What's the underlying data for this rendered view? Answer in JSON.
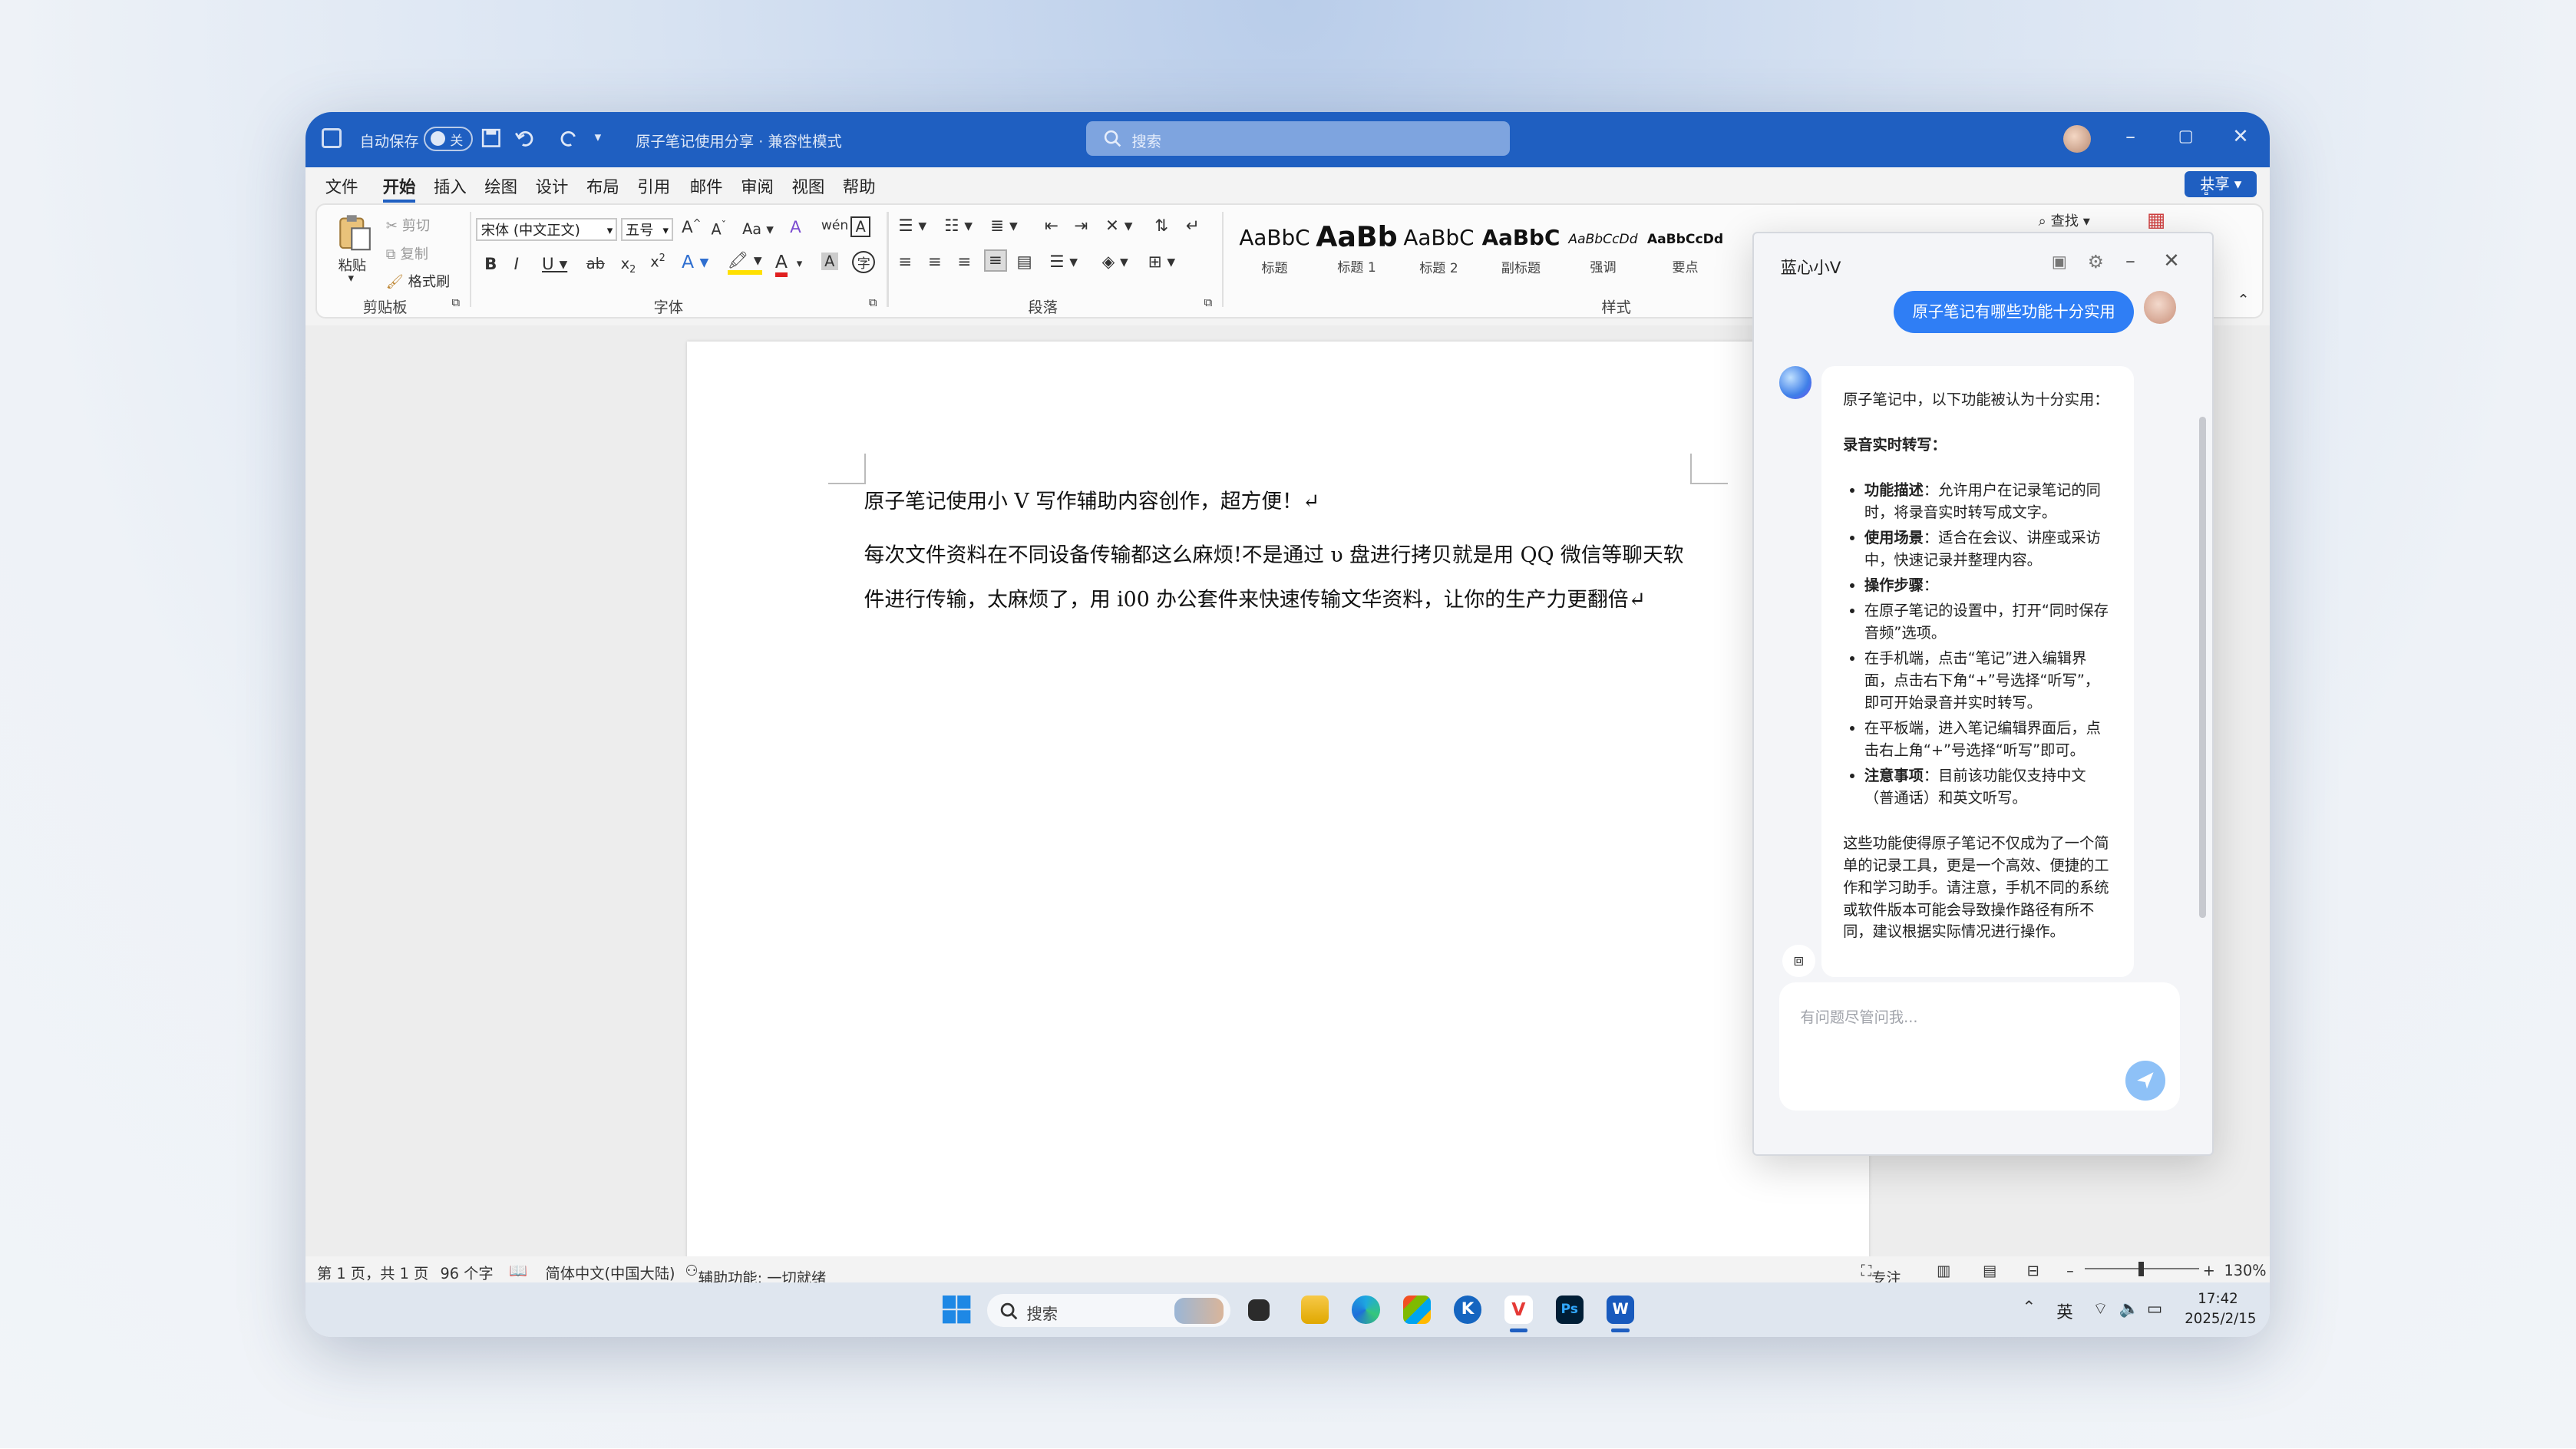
{
  "titlebar": {
    "autosave": "自动保存",
    "toggle": "关",
    "doc_title": "原子笔记使用分享 · 兼容性模式",
    "search_placeholder": "搜索"
  },
  "menu": [
    "文件",
    "开始",
    "插入",
    "绘图",
    "设计",
    "布局",
    "引用",
    "邮件",
    "审阅",
    "视图",
    "帮助"
  ],
  "share": "共享",
  "ribbon": {
    "paste": "粘贴",
    "cut": "剪切",
    "copy": "复制",
    "format_painter": "格式刷",
    "clipboard": "剪贴板",
    "font_name": "宋体 (中文正文)",
    "font_size": "五号",
    "font_group": "字体",
    "paragraph_group": "段落",
    "styles_group": "样式",
    "find": "查找",
    "styles": [
      {
        "sample": "AaBbC",
        "name": "标题"
      },
      {
        "sample": "AaBb",
        "name": "标题 1"
      },
      {
        "sample": "AaBbC",
        "name": "标题 2"
      },
      {
        "sample": "AaBbC",
        "name": "副标题"
      },
      {
        "sample": "AaBbCcDd",
        "name": "强调"
      },
      {
        "sample": "AaBbCcDd",
        "name": "要点"
      }
    ]
  },
  "document": {
    "line1": "原子笔记使用小 V 写作辅助内容创作，超方便！↵",
    "para2": "每次文件资料在不同设备传输都这么麻烦!不是通过 υ 盘进行拷贝就是用 QQ 微信等聊天软件进行传输，太麻烦了，用 i00 办公套件来快速传输文华资料，让你的生产力更翻倍↵"
  },
  "status": {
    "page": "第 1 页，共 1 页",
    "words": "96 个字",
    "lang": "简体中文(中国大陆)",
    "accessibility": "辅助功能: 一切就绪",
    "focus": "专注",
    "zoom": "130%"
  },
  "taskbar": {
    "search": "搜索",
    "ime": "英",
    "time": "17:42",
    "date": "2025/2/15"
  },
  "assistant": {
    "title": "蓝心小V",
    "user_message": "原子笔记有哪些功能十分实用",
    "reply_intro": "原子笔记中，以下功能被认为十分实用：",
    "section": "录音实时转写：",
    "bullets": [
      {
        "bold": "功能描述",
        "text": "：允许用户在记录笔记的同时，将录音实时转写成文字。"
      },
      {
        "bold": "使用场景",
        "text": "：适合在会议、讲座或采访中，快速记录并整理内容。"
      },
      {
        "bold": "操作步骤",
        "text": "："
      },
      {
        "bold": "",
        "text": "在原子笔记的设置中，打开“同时保存音频”选项。"
      },
      {
        "bold": "",
        "text": "在手机端，点击“笔记”进入编辑界面，点击右下角“+”号选择“听写”，即可开始录音并实时转写。"
      },
      {
        "bold": "",
        "text": "在平板端，进入笔记编辑界面后，点击右上角“+”号选择“听写”即可。"
      },
      {
        "bold": "注意事项",
        "text": "：目前该功能仅支持中文（普通话）和英文听写。"
      }
    ],
    "reply_outro": "这些功能使得原子笔记不仅成为了一个简单的记录工具，更是一个高效、便捷的工作和学习助手。请注意，手机不同的系统或软件版本可能会导致操作路径有所不同，建议根据实际情况进行操作。",
    "input_placeholder": "有问题尽管问我..."
  },
  "colors": {
    "accent": "#1f5fc1",
    "bubble": "#2f7ef5",
    "send": "#8ec1f7"
  }
}
